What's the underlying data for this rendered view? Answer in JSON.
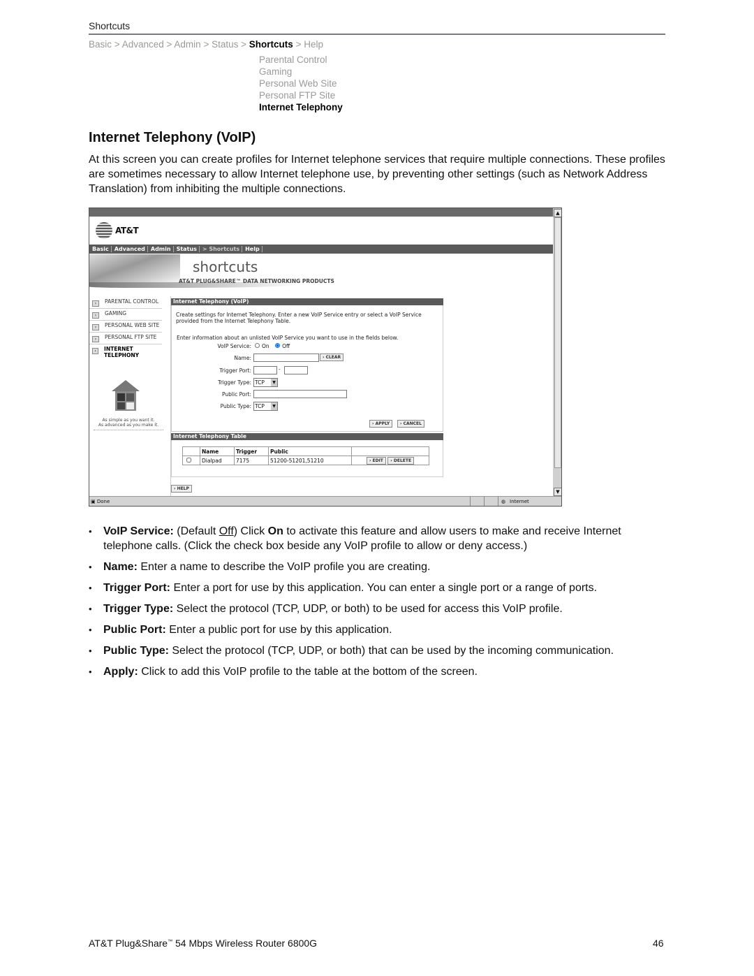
{
  "header": {
    "section_label": "Shortcuts",
    "breadcrumb": [
      "Basic",
      "Advanced",
      "Admin",
      "Status",
      "Shortcuts",
      "Help"
    ],
    "breadcrumb_active": "Shortcuts",
    "separator": ">",
    "submenu": [
      "Parental Control",
      "Gaming",
      "Personal Web Site",
      "Personal FTP Site",
      "Internet Telephony"
    ],
    "submenu_active": "Internet Telephony"
  },
  "title": "Internet Telephony (VoIP)",
  "intro": "At this screen you can create profiles for Internet telephone services that require multiple connections. These profiles are sometimes necessary to allow Internet telephone use, by preventing other settings (such as Network Address Translation) from inhibiting the multiple connections.",
  "screenshot": {
    "logo_text": "AT&T",
    "nav": [
      "Basic",
      "Advanced",
      "Admin",
      "Status",
      "> Shortcuts",
      "Help"
    ],
    "banner_title": "shortcuts",
    "banner_subtitle": "AT&T PLUG&SHARE™ DATA NETWORKING PRODUCTS",
    "sidebar": [
      {
        "label": "PARENTAL CONTROL"
      },
      {
        "label": "GAMING"
      },
      {
        "label": "PERSONAL WEB SITE"
      },
      {
        "label": "PERSONAL FTP SITE"
      },
      {
        "label": "INTERNET TELEPHONY",
        "active": true
      }
    ],
    "tagline_1": "As simple as you want it.",
    "tagline_2": "As advanced as you make it.",
    "panel_title": "Internet Telephony (VoIP)",
    "panel_desc": "Create settings for Internet Telephony. Enter a new VoIP Service entry or select a VoIP Service provided from the Internet Telephony Table.",
    "panel_instr": "Enter information about an unlisted VoIP Service you want to use in the fields below.",
    "fields": {
      "voip_service_label": "VoIP Service:",
      "on_label": "On",
      "off_label": "Off",
      "voip_service_value": "Off",
      "name_label": "Name:",
      "name_value": "",
      "trigger_port_label": "Trigger Port:",
      "trigger_port_from": "",
      "trigger_port_to": "",
      "trigger_type_label": "Trigger Type:",
      "trigger_type_value": "TCP",
      "public_port_label": "Public Port:",
      "public_port_value": "",
      "public_type_label": "Public Type:",
      "public_type_value": "TCP",
      "dash": "-"
    },
    "buttons": {
      "clear": "CLEAR",
      "apply": "APPLY",
      "cancel": "CANCEL",
      "edit": "EDIT",
      "delete": "DELETE",
      "help": "HELP"
    },
    "table_title": "Internet Telephony Table",
    "table_headers": [
      "",
      "Name",
      "Trigger",
      "Public",
      ""
    ],
    "table_rows": [
      {
        "checked": false,
        "name": "Dialpad",
        "trigger": "7175",
        "public": "51200-51201,51210"
      }
    ],
    "status_left": "Done",
    "status_right": "Internet"
  },
  "bullets": [
    {
      "term": "VoIP Service:",
      "pre": " (Default ",
      "underlined": "Off",
      "mid": ") Click ",
      "bold2": "On",
      "text": " to activate this feature and allow users to make and receive Internet telephone calls. (Click the check box beside any VoIP profile to allow or deny access.)"
    },
    {
      "term": "Name:",
      "text": " Enter a name to describe the VoIP profile you are creating."
    },
    {
      "term": "Trigger Port:",
      "text": " Enter a port for use by this application. You can enter a single port or a range of ports."
    },
    {
      "term": "Trigger Type:",
      "text": " Select the protocol (TCP, UDP, or both) to be used for access this VoIP profile."
    },
    {
      "term": "Public Port:",
      "text": " Enter a public port for use by this application."
    },
    {
      "term": "Public Type:",
      "text": " Select the protocol (TCP, UDP, or both) that can be used by the incoming communication."
    },
    {
      "term": "Apply:",
      "text": " Click to add this VoIP profile to the table at the bottom of the screen."
    }
  ],
  "footer": {
    "product_pre": "AT&T Plug&Share",
    "tm": "™",
    "product_post": " 54 Mbps Wireless Router 6800G",
    "page_number": "46"
  }
}
